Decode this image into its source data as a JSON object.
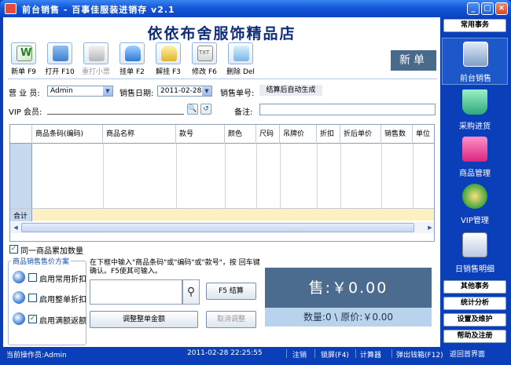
{
  "window": {
    "title": "前台销售 - 百事佳服装进销存 v2.1",
    "controls": {
      "minimize": "_",
      "maximize": "□",
      "close": "×"
    }
  },
  "shop_title": "依依布舍服饰精品店",
  "toolbar": [
    {
      "label": "新单 F9",
      "icon": "new-bill-icon",
      "enabled": true
    },
    {
      "label": "打开 F10",
      "icon": "open-folder-icon",
      "enabled": true
    },
    {
      "label": "重打小票",
      "icon": "printer-icon",
      "enabled": false
    },
    {
      "label": "挂单 F2",
      "icon": "lock-icon",
      "enabled": true
    },
    {
      "label": "解挂 F3",
      "icon": "unlock-icon",
      "enabled": true
    },
    {
      "label": "修改 F6",
      "icon": "edit-icon",
      "enabled": true
    },
    {
      "label": "删除 Del",
      "icon": "delete-icon",
      "enabled": true
    }
  ],
  "mode_label": "新单",
  "form": {
    "salesperson_label": "营 业 员:",
    "salesperson_value": "Admin",
    "date_label": "销售日期:",
    "date_value": "2011-02-28",
    "bill_no_label": "销售单号:",
    "bill_no_value": "结算后自动生成",
    "vip_label": "VIP 会员:",
    "vip_value": "",
    "note_label": "备注:",
    "note_value": ""
  },
  "grid": {
    "columns": [
      "商品条码(编码)",
      "商品名称",
      "款号",
      "颜色",
      "尺码",
      "吊牌价",
      "折扣",
      "折后单价",
      "销售数",
      "单位"
    ],
    "total_label": "合计"
  },
  "accumulate_checkbox": {
    "label": "同一商品累加数量",
    "checked": true
  },
  "price_scheme": {
    "legend": "商品销售售价方案",
    "options": [
      {
        "label": "启用常用折扣",
        "checked": false
      },
      {
        "label": "启用整单折扣",
        "checked": false
      },
      {
        "label": "启用满额返额",
        "checked": true
      }
    ]
  },
  "hint": "在下框中输入\"商品条码\"或\"编码\"或\"款号\"，按 回车键 确认。F5使其可输入。",
  "buttons": {
    "checkout": "F5 结算",
    "adjust_amount": "调整整单金额",
    "cancel_adjust": "取消调整"
  },
  "summary": {
    "price_text": "售:￥0.00",
    "qty_text": "数量:0 \\ 原价:￥0.00"
  },
  "statusbar": {
    "operator": "当前操作员:Admin",
    "datetime": "2011-02-28  22:25:55",
    "logout": "注销",
    "lock": "锁屏(F4)",
    "calculator": "计算器",
    "cash_drawer": "弹出钱箱(F12)",
    "home": "返回首界面"
  },
  "sidebar": {
    "common": "常用事务",
    "nav": [
      {
        "label": "前台销售",
        "active": true
      },
      {
        "label": "采购进货",
        "active": false
      },
      {
        "label": "商品管理",
        "active": false
      },
      {
        "label": "VIP管理",
        "active": false
      },
      {
        "label": "日销售明细",
        "active": false
      }
    ],
    "bottom": [
      "其他事务",
      "统计分析",
      "设置及维护",
      "帮助及注册"
    ]
  },
  "colors": {
    "frame": "#0a3fb9",
    "shop_title": "#102d7a",
    "price_panel": "#4c6c8f",
    "qty_panel": "#b9d3ec",
    "total_row": "#fdf1c2"
  }
}
